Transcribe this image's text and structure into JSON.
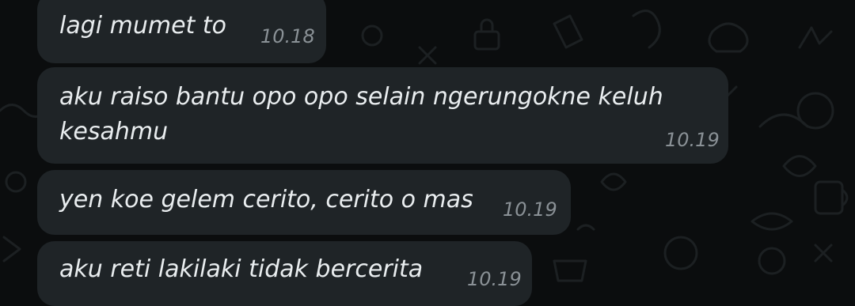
{
  "messages": [
    {
      "lines": [
        "lagi mumet to"
      ],
      "time": "10.18"
    },
    {
      "lines": [
        "aku raiso bantu opo opo selain ngerungokne keluh",
        "kesahmu"
      ],
      "time": "10.19"
    },
    {
      "lines": [
        "yen koe gelem cerito, cerito o mas"
      ],
      "time": "10.19"
    },
    {
      "lines": [
        "aku reti lakilaki tidak bercerita"
      ],
      "time": "10.19"
    }
  ],
  "theme": {
    "bubble": "#1f2427",
    "text": "#e9edef",
    "timestamp": "#8a9196",
    "background": "#0b0d0e"
  }
}
